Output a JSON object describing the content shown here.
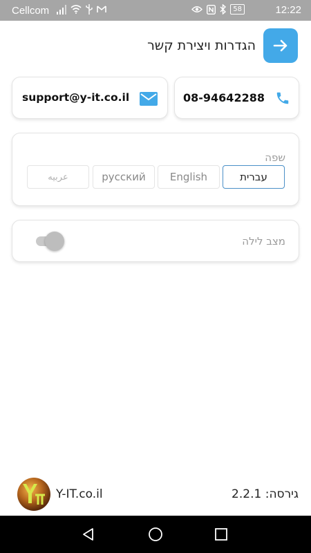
{
  "status_bar": {
    "carrier": "Cellcom",
    "battery": "58",
    "time": "12:22"
  },
  "header": {
    "title": "הגדרות ויצירת קשר",
    "back_icon": "arrow-right-icon"
  },
  "contact": {
    "phone": "08-94642288",
    "email": "support@y-it.co.il",
    "accent_color": "#43a9e8"
  },
  "language": {
    "label": "שפה",
    "options": [
      "עברית",
      "English",
      "русский",
      "عربيه"
    ],
    "selected": "עברית"
  },
  "night_mode": {
    "label": "מצב לילה",
    "enabled": false
  },
  "footer": {
    "site": "Y-IT.co.il",
    "version": "גירסה: 2.2.1"
  }
}
